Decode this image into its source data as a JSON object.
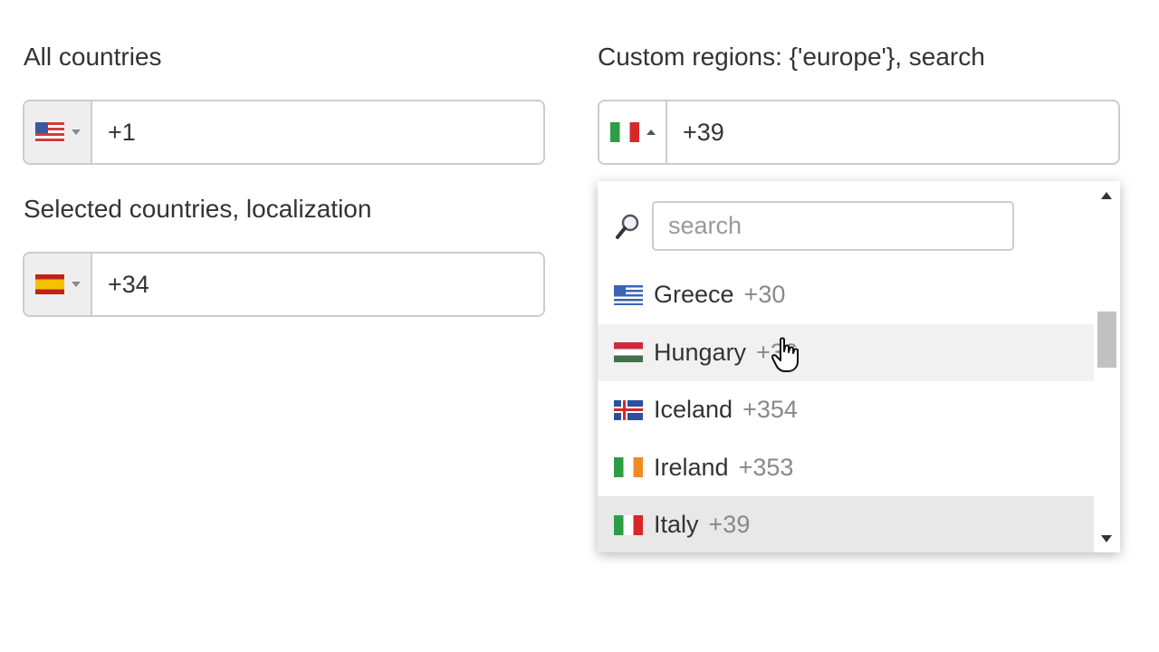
{
  "fields": {
    "all_countries": {
      "label": "All countries",
      "flag": "us",
      "value": "+1"
    },
    "selected_countries": {
      "label": "Selected countries, localization",
      "flag": "es",
      "value": "+34"
    },
    "custom_regions": {
      "label": "Custom regions: {'europe'}, search",
      "flag": "it",
      "value": "+39"
    }
  },
  "dropdown": {
    "search_placeholder": "search",
    "scroll_position": 0.35,
    "items": [
      {
        "flag": "gr",
        "name": "Greece",
        "code": "+30",
        "state": "normal"
      },
      {
        "flag": "hu",
        "name": "Hungary",
        "code": "+36",
        "state": "hover"
      },
      {
        "flag": "is",
        "name": "Iceland",
        "code": "+354",
        "state": "normal"
      },
      {
        "flag": "ie",
        "name": "Ireland",
        "code": "+353",
        "state": "normal"
      },
      {
        "flag": "it",
        "name": "Italy",
        "code": "+39",
        "state": "selected"
      }
    ]
  },
  "colors": {
    "field_border": "#cccccc",
    "flag_button_bg": "#eeeeee",
    "hover_row": "#f1f1f1",
    "selected_row": "#e8e8e8",
    "dial_code": "#888888"
  },
  "icons": {
    "search": "magnifier-icon",
    "cursor": "hand-pointer-icon"
  }
}
